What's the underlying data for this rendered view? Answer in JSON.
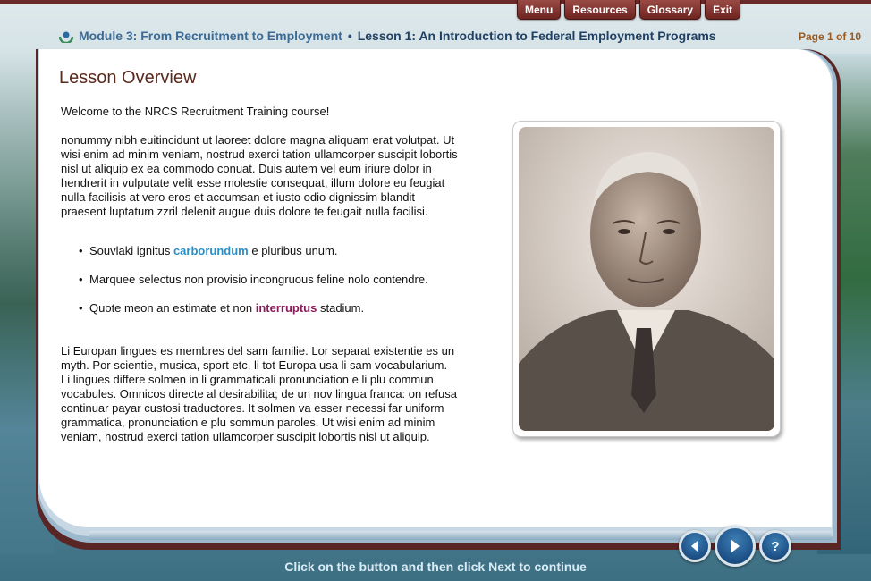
{
  "top_nav": {
    "menu": "Menu",
    "resources": "Resources",
    "glossary": "Glossary",
    "exit": "Exit"
  },
  "breadcrumb": {
    "module": "Module 3: From Recruitment to Employment",
    "separator": "•",
    "lesson": "Lesson 1: An Introduction to Federal Employment Programs"
  },
  "page_indicator": "Page 1 of 10",
  "lesson": {
    "title": "Lesson Overview",
    "welcome": "Welcome to the NRCS Recruitment Training course!",
    "paragraph1": "nonummy nibh euitincidunt ut laoreet dolore magna aliquam erat volutpat. Ut wisi enim ad minim veniam, nostrud exerci tation ullamcorper suscipit lobortis nisl ut aliquip ex ea commodo conuat. Duis autem vel eum iriure dolor in hendrerit in vulputate velit esse molestie consequat, illum dolore eu feugiat nulla facilisis at vero eros et accumsan et iusto odio dignissim blandit praesent luptatum zzril delenit augue duis dolore te feugait nulla facilisi.",
    "bullets": [
      {
        "before": "Souvlaki ignitus ",
        "highlight": "carborundum",
        "after": " e pluribus unum."
      },
      {
        "before": "Marquee selectus non provisio incongruous feline nolo contendre.",
        "highlight": "",
        "after": ""
      },
      {
        "before": "Quote meon an estimate et non ",
        "highlight": "interruptus",
        "after": " stadium."
      }
    ],
    "paragraph2": "Li Europan lingues es membres del sam familie. Lor separat existentie es un myth. Por scientie, musica, sport etc, li tot Europa usa li sam vocabularium. Li lingues differe solmen in li grammaticali pronunciation e li plu commun vocabules. Omnicos directe al desirabilita; de un nov lingua franca: on refusa continuar payar custosi traductores. It solmen va esser necessi far uniform grammatica, pronunciation e plu sommun paroles. Ut wisi enim ad minim veniam, nostrud exerci tation ullamcorper suscipit lobortis nisl ut aliquip."
  },
  "controls": {
    "help_label": "?"
  },
  "instruction": "Click on the button and then click Next to continue",
  "colors": {
    "accent_tab": "#8a3a35",
    "breadcrumb": "#2d4f78",
    "page_indicator": "#9a5a20",
    "title": "#5a2a1e",
    "highlight_blue": "#2a8fc8",
    "highlight_purple": "#8a1a5a",
    "nav_button": "#1c4f85"
  }
}
